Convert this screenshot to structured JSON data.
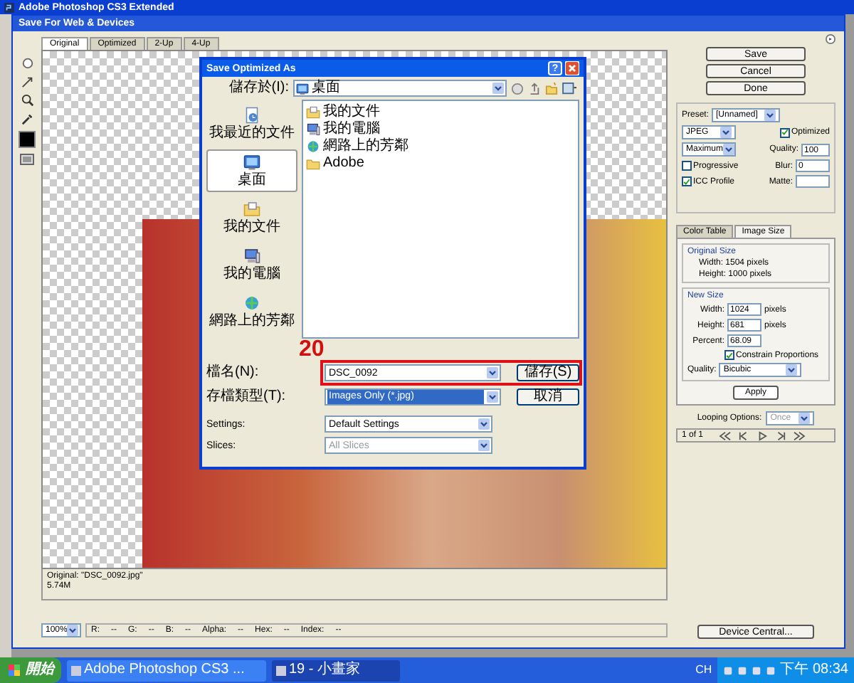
{
  "app_title": "Adobe Photoshop CS3 Extended",
  "window": {
    "title": "Save For Web & Devices"
  },
  "view_tabs": [
    {
      "label": "Original",
      "selected": true
    },
    {
      "label": "Optimized",
      "selected": false
    },
    {
      "label": "2-Up",
      "selected": false
    },
    {
      "label": "4-Up",
      "selected": false
    }
  ],
  "image_info": [
    "Original: \"DSC_0092.jpg\"",
    "5.74M"
  ],
  "status_bar": {
    "zoom": "100%",
    "readouts": [
      {
        "label": "R:",
        "value": "--"
      },
      {
        "label": "G:",
        "value": "--"
      },
      {
        "label": "B:",
        "value": "--"
      },
      {
        "label": "Alpha:",
        "value": "--"
      },
      {
        "label": "Hex:",
        "value": "--"
      },
      {
        "label": "Index:",
        "value": "--"
      }
    ]
  },
  "device_central": "Device Central...",
  "buttons": [
    "Save",
    "Cancel",
    "Done"
  ],
  "settings": {
    "preset_label": "Preset:",
    "preset": "[Unnamed]",
    "format": "JPEG",
    "compression": "Maximum",
    "optimized": {
      "label": "Optimized",
      "checked": true
    },
    "quality_label": "Quality:",
    "quality": "100",
    "progressive": {
      "label": "Progressive",
      "checked": false
    },
    "blur_label": "Blur:",
    "blur": "0",
    "icc_profile": {
      "label": "ICC Profile",
      "checked": true
    },
    "matte_label": "Matte:"
  },
  "panel_tabs": [
    {
      "label": "Color Table",
      "selected": false
    },
    {
      "label": "Image Size",
      "selected": true
    }
  ],
  "image_size": {
    "original_title": "Original Size",
    "original_width": "Width: 1504 pixels",
    "original_height": "Height: 1000 pixels",
    "new_title": "New Size",
    "fields": [
      {
        "label": "Width:",
        "value": "1024",
        "unit": "pixels"
      },
      {
        "label": "Height:",
        "value": "681",
        "unit": "pixels"
      },
      {
        "label": "Percent:",
        "value": "68.09"
      }
    ],
    "constrain": {
      "label": "Constrain Proportions",
      "checked": true
    },
    "quality_label": "Quality:",
    "quality": "Bicubic",
    "apply": "Apply"
  },
  "animation": {
    "looping_label": "Looping Options:",
    "looping": "Once",
    "frame": "1 of 1"
  },
  "save_dialog": {
    "title": "Save Optimized As",
    "help": "?",
    "save_in_label": "儲存於(I):",
    "save_in": "桌面",
    "places": [
      {
        "label": "我最近的文件",
        "kind": "recent",
        "selected": false
      },
      {
        "label": "桌面",
        "kind": "desktop",
        "selected": true
      },
      {
        "label": "我的文件",
        "kind": "documents",
        "selected": false
      },
      {
        "label": "我的電腦",
        "kind": "computer",
        "selected": false
      },
      {
        "label": "網路上的芳鄰",
        "kind": "network",
        "selected": false
      }
    ],
    "files": [
      {
        "name": "我的文件",
        "kind": "documents"
      },
      {
        "name": "我的電腦",
        "kind": "computer"
      },
      {
        "name": "網路上的芳鄰",
        "kind": "network"
      },
      {
        "name": "Adobe",
        "kind": "folder"
      }
    ],
    "filename_label": "檔名(N):",
    "filename": "DSC_0092",
    "type_label": "存檔類型(T):",
    "type": "Images Only (*.jpg)",
    "save": "儲存(S)",
    "cancel": "取消",
    "settings_label": "Settings:",
    "settings": "Default Settings",
    "slices_label": "Slices:",
    "slices": "All Slices",
    "slices_disabled": true
  },
  "annotation": "20",
  "taskbar": {
    "start": "開始",
    "tasks": [
      {
        "label": "Adobe Photoshop CS3 ...",
        "selected": false
      },
      {
        "label": "19 - 小畫家",
        "selected": true
      }
    ],
    "language": "CH",
    "clock": "下午 08:34"
  }
}
